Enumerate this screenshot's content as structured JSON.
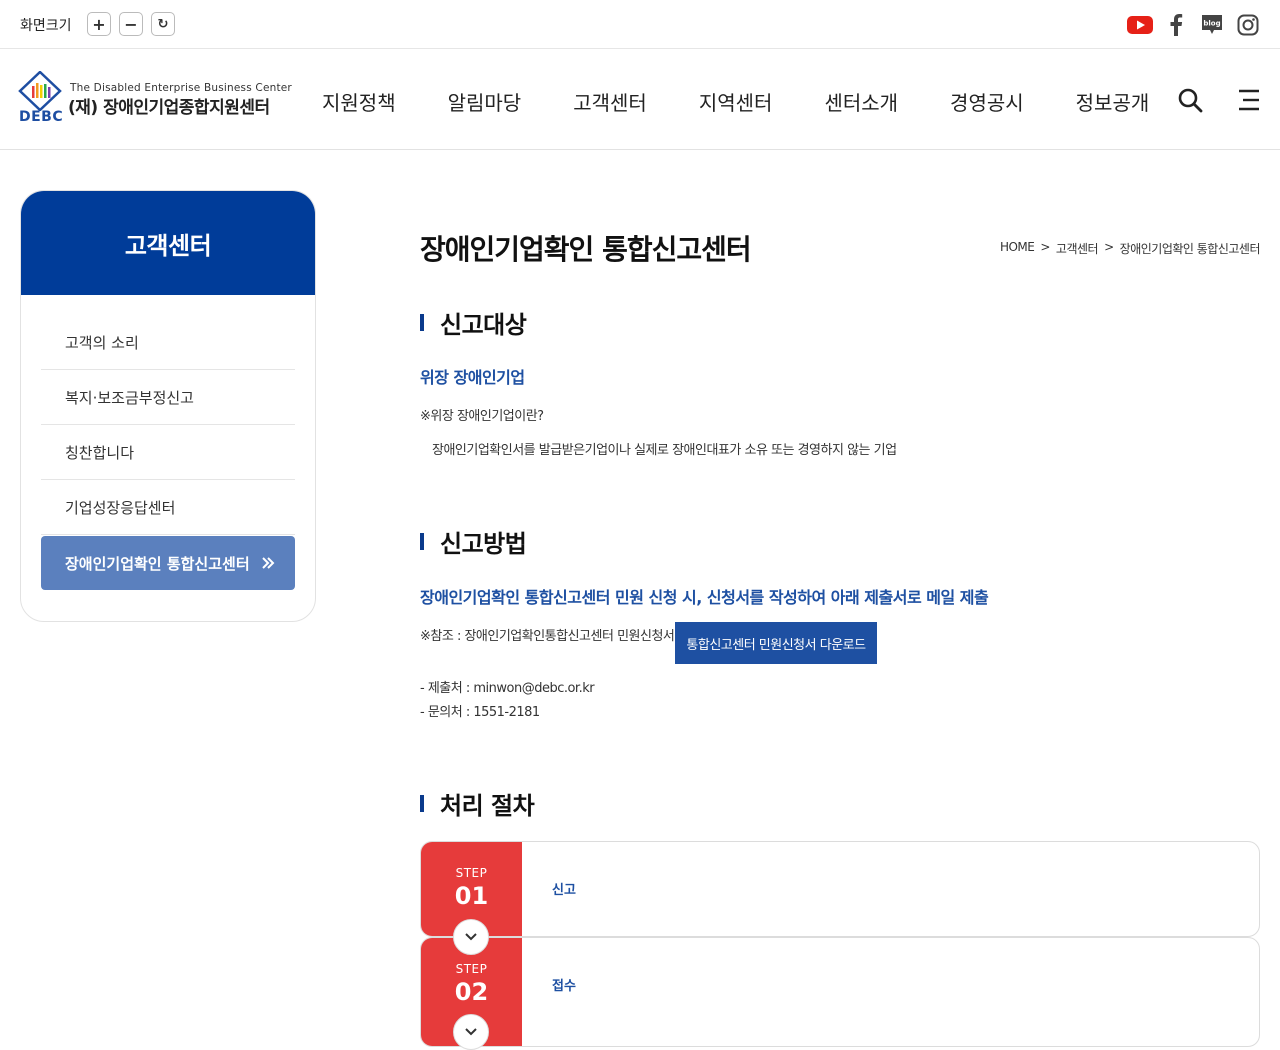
{
  "utility": {
    "zoom_label": "화면크기",
    "zoom_in": "+",
    "zoom_out": "−",
    "zoom_reset": "↻",
    "social_icons": [
      "youtube-icon",
      "facebook-icon",
      "blog-icon",
      "instagram-icon"
    ],
    "blog_text": "blog"
  },
  "header": {
    "logo": {
      "en": "The Disabled Enterprise Business Center",
      "ko": "(재) 장애인기업종합지원센터",
      "abbr": "DEBC"
    },
    "nav": [
      "지원정책",
      "알림마당",
      "고객센터",
      "지역센터",
      "센터소개",
      "경영공시",
      "정보공개"
    ],
    "icons": [
      "search-icon",
      "menu-icon"
    ]
  },
  "sidebar": {
    "title": "고객센터",
    "items": [
      {
        "label": "고객의 소리"
      },
      {
        "label": "복지·보조금부정신고"
      },
      {
        "label": "칭찬합니다"
      },
      {
        "label": "기업성장응답센터"
      },
      {
        "label": "장애인기업확인 통합신고센터",
        "active": true
      }
    ]
  },
  "content": {
    "title": "장애인기업확인 통합신고센터",
    "breadcrumb": [
      "HOME",
      ">",
      "고객센터",
      ">",
      "장애인기업확인 통합신고센터"
    ],
    "section1": {
      "heading": "신고대상",
      "sub": "위장 장애인기업",
      "question": "※위장 장애인기업이란?",
      "definition": "장애인기업확인서를 발급받은기업이나 실제로 장애인대표가 소유 또는 경영하지 않는 기업"
    },
    "section2": {
      "heading": "신고방법",
      "sub": "장애인기업확인 통합신고센터 민원 신청 시, 신청서를 작성하여 아래 제출서로 메일 제출",
      "reference": "※참조 : 장애인기업확인통합신고센터 민원신청서",
      "download_button": "통합신고센터 민원신청서 다운로드",
      "submit": "- 제출처 : minwon@debc.or.kr",
      "contact": "- 문의처 : 1551-2181"
    },
    "section3": {
      "heading": "처리 절차",
      "steps": [
        {
          "label": "STEP",
          "num": "01",
          "text": "신고"
        },
        {
          "label": "STEP",
          "num": "02",
          "text": "접수"
        }
      ]
    }
  },
  "colors": {
    "primary_navy": "#003c99",
    "accent_blue": "#1e50a2",
    "sidebar_active": "#5b80be",
    "step_red": "#e63b3b"
  }
}
